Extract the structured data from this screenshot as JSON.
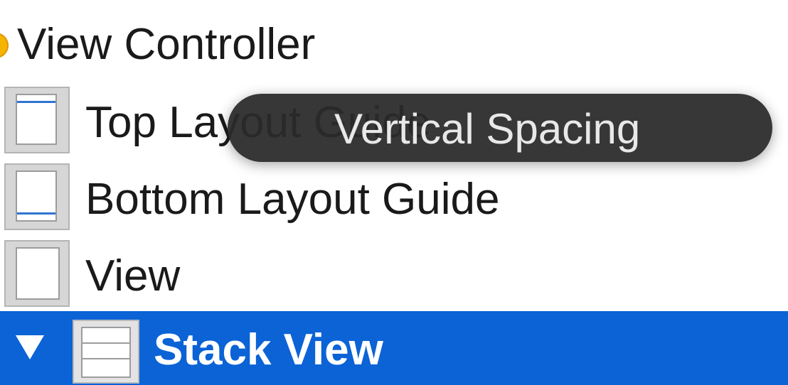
{
  "outline": {
    "view_controller": {
      "label": "View Controller",
      "icon": "view-controller-icon"
    },
    "children": [
      {
        "label": "Top Layout Guide",
        "icon": "top-layout-guide-icon"
      },
      {
        "label": "Bottom Layout Guide",
        "icon": "bottom-layout-guide-icon"
      },
      {
        "label": "View",
        "icon": "view-icon"
      }
    ],
    "selected": {
      "label": "Stack View",
      "icon": "stack-view-icon",
      "expanded": true
    }
  },
  "tooltip": {
    "label": "Vertical Spacing"
  },
  "colors": {
    "selection": "#0b63d6",
    "guide_accent": "#2f74d0",
    "view_controller_icon": "#f5b400",
    "tooltip_bg": "#2a2a2a"
  }
}
